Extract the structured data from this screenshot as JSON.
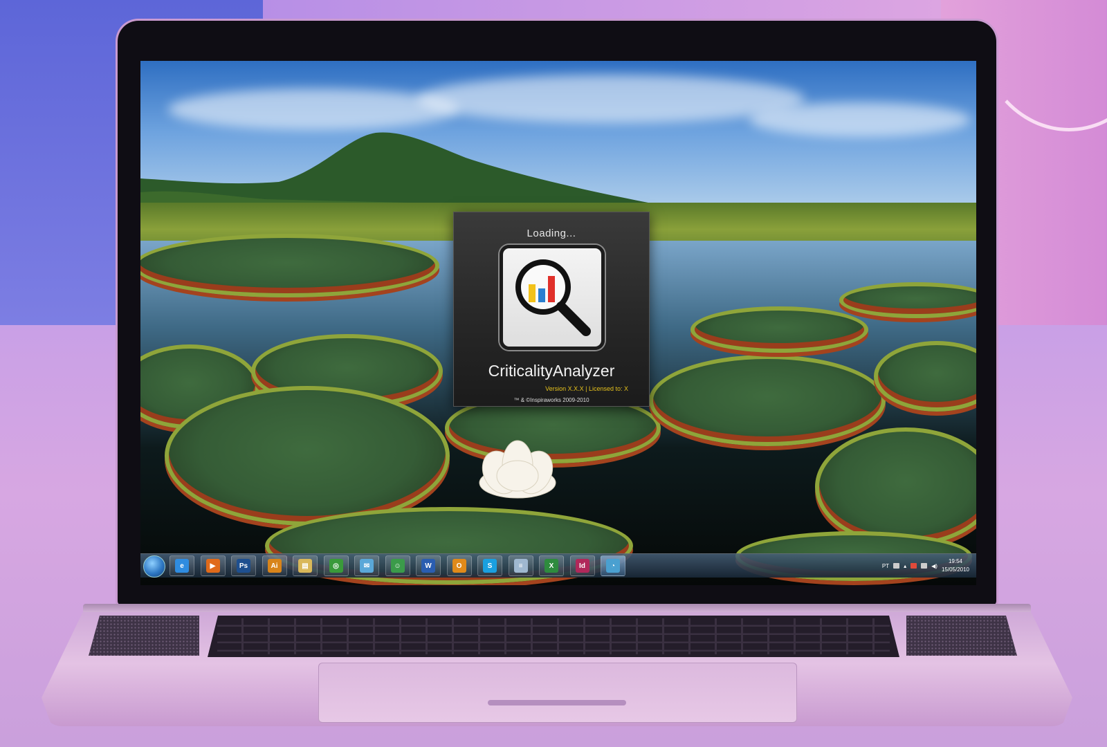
{
  "splash": {
    "loading_text": "Loading...",
    "app_name": "CriticalityAnalyzer",
    "version_text": "Version X.X.X | Licensed to: X",
    "copyright_text": "™ & ©Inspiraworks 2009-2010"
  },
  "taskbar": {
    "apps": [
      {
        "name": "internet-explorer",
        "glyph": "e",
        "color": "#2f8ce0"
      },
      {
        "name": "media-player",
        "glyph": "▶",
        "color": "#e06a1a"
      },
      {
        "name": "photoshop",
        "glyph": "Ps",
        "color": "#1e4f8f"
      },
      {
        "name": "illustrator",
        "glyph": "Ai",
        "color": "#d8841a"
      },
      {
        "name": "file-explorer",
        "glyph": "▤",
        "color": "#d9b85a"
      },
      {
        "name": "chrome",
        "glyph": "◎",
        "color": "#3a9a3a"
      },
      {
        "name": "messenger-chat",
        "glyph": "✉",
        "color": "#5aa8d8"
      },
      {
        "name": "live-messenger",
        "glyph": "☺",
        "color": "#3b9b4a"
      },
      {
        "name": "word",
        "glyph": "W",
        "color": "#2a5db0"
      },
      {
        "name": "outlook",
        "glyph": "O",
        "color": "#e08a1a"
      },
      {
        "name": "skype",
        "glyph": "S",
        "color": "#1aa0e0"
      },
      {
        "name": "notepad",
        "glyph": "≡",
        "color": "#9fb8d0"
      },
      {
        "name": "excel",
        "glyph": "X",
        "color": "#2e8b3e"
      },
      {
        "name": "indesign",
        "glyph": "Id",
        "color": "#b0285a"
      },
      {
        "name": "criticality-analyzer",
        "glyph": "◔",
        "color": "#4aa0d0"
      }
    ],
    "tray": {
      "language": "PT",
      "time": "19:54",
      "date": "15/05/2010"
    }
  },
  "colors": {
    "splash_version": "#e6c21d",
    "taskbar_active": "#5082b4"
  }
}
